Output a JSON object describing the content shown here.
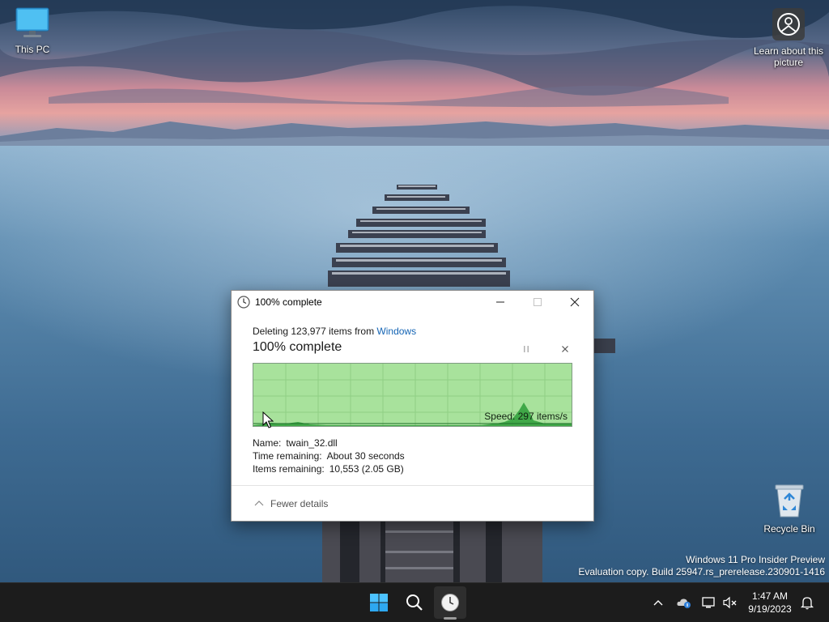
{
  "desktop": {
    "icons": {
      "this_pc": {
        "label": "This PC"
      },
      "recycle_bin": {
        "label": "Recycle Bin"
      },
      "learn": {
        "label": "Learn about this picture"
      }
    },
    "watermark": {
      "line1": "Windows 11 Pro Insider Preview",
      "line2": "Evaluation copy. Build 25947.rs_prerelease.230901-1416"
    }
  },
  "dialog": {
    "title": "100% complete",
    "operation_prefix": "Deleting 123,977 items from ",
    "operation_location": "Windows",
    "status": "100% complete",
    "progress_percent": 100,
    "speed_label": "Speed: 297 items/s",
    "details": {
      "name_label": "Name:",
      "name_value": "twain_32.dll",
      "time_label": "Time remaining:",
      "time_value": "About 30 seconds",
      "items_label": "Items remaining:",
      "items_value": "10,553 (2.05 GB)"
    },
    "fewer_details_label": "Fewer details",
    "icons": {
      "title": "clock-icon",
      "minimize": "minimize-icon",
      "maximize": "maximize-icon",
      "close": "close-icon",
      "pause": "pause-icon",
      "cancel": "cancel-icon",
      "chevron": "chevron-up-icon"
    }
  },
  "taskbar": {
    "clock_time": "1:47 AM",
    "clock_date": "9/19/2023",
    "icons": [
      "windows-start-icon",
      "search-icon",
      "clock-app-icon",
      "chevron-up-icon",
      "onedrive-cloud-icon",
      "network-icon",
      "volume-muted-icon",
      "notification-bell-icon"
    ]
  },
  "colors": {
    "graph_fill": "#a8e29c",
    "graph_peak": "#2e9e3a",
    "link": "#1464b4",
    "taskbar": "#1c1c1c"
  }
}
